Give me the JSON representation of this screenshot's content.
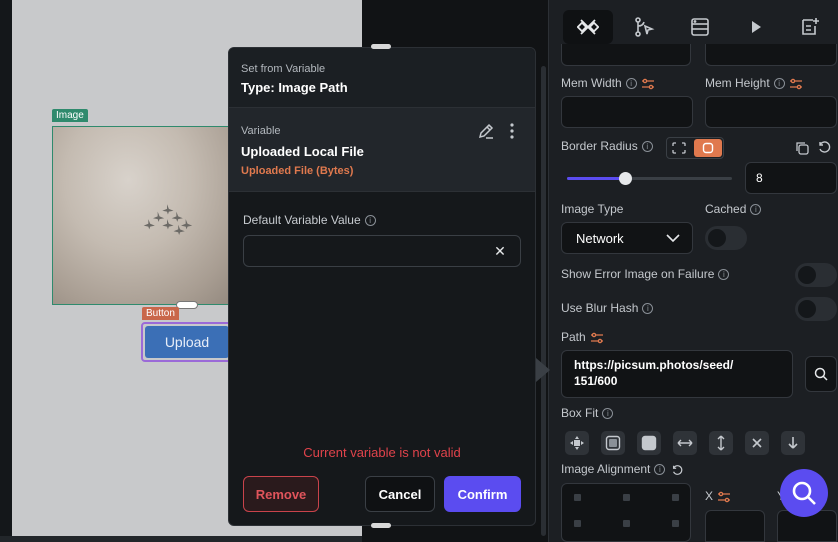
{
  "canvas": {
    "image_tag": "Image",
    "button_tag": "Button",
    "upload_label": "Upload"
  },
  "dialog": {
    "subtitle": "Set from Variable",
    "title": "Type: Image Path",
    "variable_label": "Variable",
    "variable_name": "Uploaded Local File",
    "variable_type": "Uploaded File (Bytes)",
    "default_label": "Default Variable Value",
    "default_value": "",
    "error": "Current variable is not valid",
    "remove_label": "Remove",
    "cancel_label": "Cancel",
    "confirm_label": "Confirm"
  },
  "panel": {
    "mem_width_label": "Mem Width",
    "mem_height_label": "Mem Height",
    "border_radius_label": "Border Radius",
    "border_radius_value": "8",
    "border_radius_slider": 0.35,
    "image_type_label": "Image Type",
    "image_type_value": "Network",
    "cached_label": "Cached",
    "show_error_label": "Show Error Image on Failure",
    "blur_hash_label": "Use Blur Hash",
    "path_label": "Path",
    "path_value_line1": "https://picsum.photos/seed/",
    "path_value_line2": "151/600",
    "box_fit_label": "Box Fit",
    "image_alignment_label": "Image Alignment",
    "x_label": "X",
    "y_label": "Y"
  },
  "colors": {
    "accent": "#5b4cf0",
    "error": "#e0434b",
    "variable_type": "#e0794e",
    "image_tag": "#2f8a6d",
    "button_tag": "#c9674a",
    "upload_button": "#3b6fb6"
  }
}
